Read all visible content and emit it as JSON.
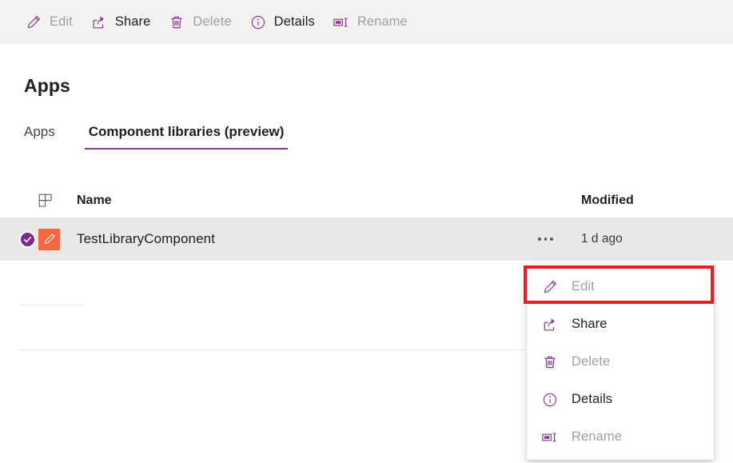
{
  "commandbar": {
    "items": [
      {
        "label": "Edit",
        "icon": "pencil-icon",
        "enabled": false
      },
      {
        "label": "Share",
        "icon": "share-icon",
        "enabled": true
      },
      {
        "label": "Delete",
        "icon": "trash-icon",
        "enabled": false
      },
      {
        "label": "Details",
        "icon": "info-icon",
        "enabled": true
      },
      {
        "label": "Rename",
        "icon": "rename-icon",
        "enabled": false
      }
    ]
  },
  "page": {
    "title": "Apps"
  },
  "tabs": [
    {
      "label": "Apps",
      "active": false
    },
    {
      "label": "Component libraries (preview)",
      "active": true
    }
  ],
  "list": {
    "columns": {
      "grid_icon": "grid-icon",
      "name": "Name",
      "modified": "Modified"
    },
    "rows": [
      {
        "selected": true,
        "check_icon": "checkmark-icon",
        "app_icon": "pencil-app-icon",
        "name": "TestLibraryComponent",
        "overflow": "ellipsis-icon",
        "modified": "1 d ago"
      }
    ]
  },
  "context_menu": {
    "items": [
      {
        "label": "Edit",
        "icon": "pencil-icon",
        "enabled": false,
        "highlighted": true
      },
      {
        "label": "Share",
        "icon": "share-icon",
        "enabled": true,
        "highlighted": false
      },
      {
        "label": "Delete",
        "icon": "trash-icon",
        "enabled": false,
        "highlighted": false
      },
      {
        "label": "Details",
        "icon": "info-icon",
        "enabled": true,
        "highlighted": false
      },
      {
        "label": "Rename",
        "icon": "rename-icon",
        "enabled": false,
        "highlighted": false
      }
    ]
  },
  "colors": {
    "accent_purple": "#8a3b8f",
    "check_purple": "#7b2a8e",
    "app_tile_orange": "#f4683f",
    "highlight_red": "#ed1c24",
    "commandbar_bg": "#f3f2f1",
    "row_selected_bg": "#e9e8e7"
  }
}
